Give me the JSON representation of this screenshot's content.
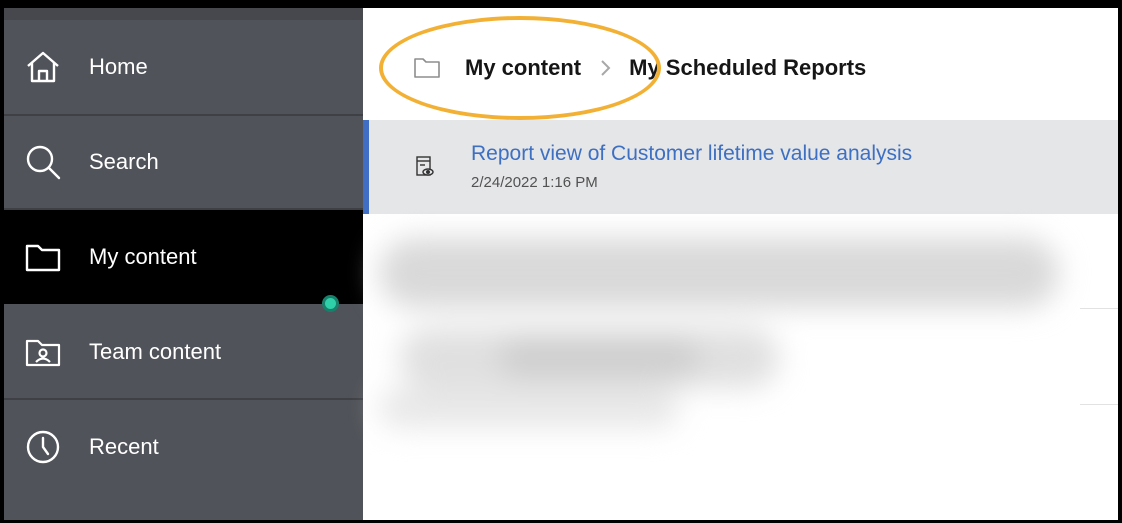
{
  "sidebar": {
    "items": [
      {
        "label": "Home",
        "icon": "home-icon",
        "active": false
      },
      {
        "label": "Search",
        "icon": "search-icon",
        "active": false
      },
      {
        "label": "My content",
        "icon": "folder-icon",
        "active": true
      },
      {
        "label": "Team content",
        "icon": "team-folder-icon",
        "active": false
      },
      {
        "label": "Recent",
        "icon": "clock-icon",
        "active": false
      }
    ]
  },
  "breadcrumb": {
    "items": [
      {
        "label": "My content"
      },
      {
        "label": "My Scheduled Reports"
      }
    ]
  },
  "content": {
    "rows": [
      {
        "title": "Report view of Customer lifetime value analysis",
        "date": "2/24/2022 1:16 PM",
        "icon": "report-view-icon"
      }
    ]
  },
  "colors": {
    "sidebar_bg": "#505359",
    "active_bg": "#000000",
    "status_dot": "#2ecfa9",
    "highlight": "#f2b134",
    "link": "#3d6fc2",
    "row_accent": "#3f6ec2"
  }
}
